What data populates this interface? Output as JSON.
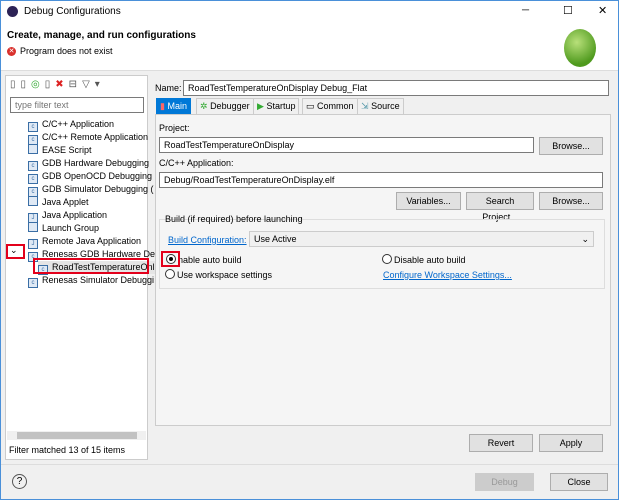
{
  "window": {
    "title": "Debug Configurations",
    "minimize": "─",
    "maximize": "☐",
    "close": "✕"
  },
  "header": {
    "title": "Create, manage, and run configurations",
    "error": "Program does not exist"
  },
  "left": {
    "filter_placeholder": "type filter text",
    "items": [
      {
        "label": "C/C++ Application",
        "icon": "c"
      },
      {
        "label": "C/C++ Remote Application",
        "icon": "c"
      },
      {
        "label": "EASE Script",
        "icon": "script"
      },
      {
        "label": "GDB Hardware Debugging",
        "icon": "c"
      },
      {
        "label": "GDB OpenOCD Debugging",
        "icon": "c"
      },
      {
        "label": "GDB Simulator Debugging (",
        "icon": "c"
      },
      {
        "label": "Java Applet",
        "icon": "applet"
      },
      {
        "label": "Java Application",
        "icon": "j"
      },
      {
        "label": "Launch Group",
        "icon": "launch"
      },
      {
        "label": "Remote Java Application",
        "icon": "j"
      },
      {
        "label": "Renesas GDB Hardware Deb",
        "icon": "c"
      },
      {
        "label": "RoadTestTemperatureOnl",
        "icon": "c"
      },
      {
        "label": "Renesas Simulator Debuggi",
        "icon": "c"
      }
    ],
    "status": "Filter matched 13 of 15 items"
  },
  "main": {
    "name_label": "Name:",
    "name_value": "RoadTestTemperatureOnDisplay Debug_Flat",
    "tabs": [
      "Main",
      "Debugger",
      "Startup",
      "Common",
      "Source"
    ],
    "project_label": "Project:",
    "project_value": "RoadTestTemperatureOnDisplay",
    "browse": "Browse...",
    "app_label": "C/C++ Application:",
    "app_value": "Debug/RoadTestTemperatureOnDisplay.elf",
    "variables": "Variables...",
    "search_project": "Search Project...",
    "build_group": "Build (if required) before launching",
    "build_config_link": "Build Configuration:",
    "build_config_value": "Use Active",
    "enable_auto": "nable auto build",
    "disable_auto": "Disable auto build",
    "use_workspace": "Use workspace settings",
    "configure_link": "Configure Workspace Settings...",
    "revert": "Revert",
    "apply": "Apply"
  },
  "footer": {
    "help": "?",
    "debug": "Debug",
    "close": "Close"
  }
}
